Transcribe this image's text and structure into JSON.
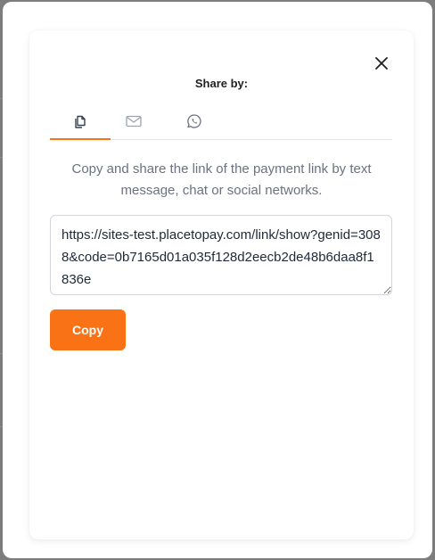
{
  "modal": {
    "title": "Share by:",
    "tabs": [
      {
        "icon": "copy-documents-icon",
        "active": true
      },
      {
        "icon": "mail-icon",
        "active": false
      },
      {
        "icon": "whatsapp-icon",
        "active": false
      }
    ],
    "description": "Copy and share the link of the payment link by text message, chat or social networks.",
    "link_value": "https://sites-test.placetopay.com/link/show?genid=3088&code=0b7165d01a035f128d2eecb2de48b6daa8f1836e",
    "copy_label": "Copy"
  },
  "colors": {
    "accent": "#f97316",
    "muted_text": "#6b7280",
    "icon_gray": "#9ca3af",
    "overlay": "#7d7d7d"
  }
}
